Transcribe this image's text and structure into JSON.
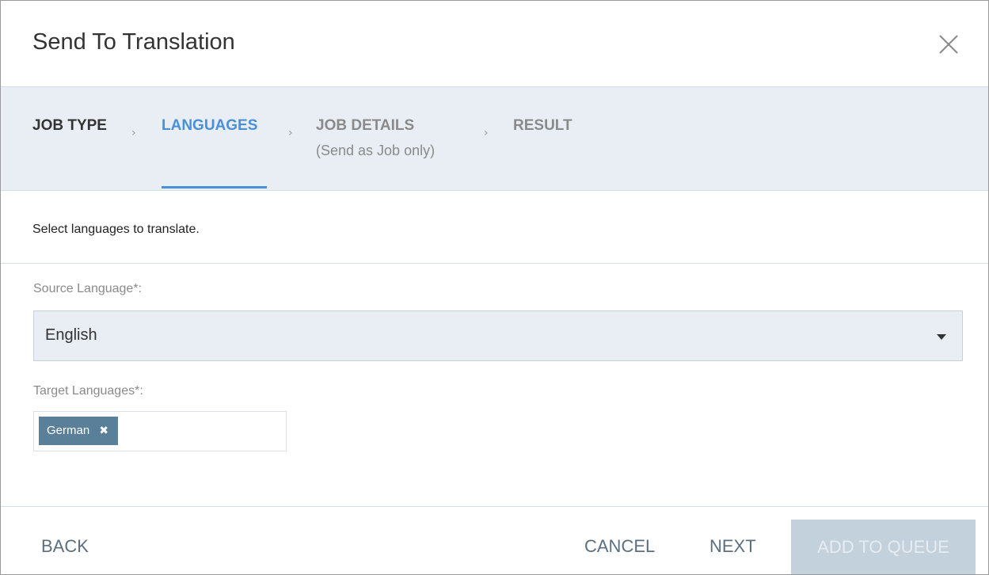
{
  "dialog": {
    "title": "Send To Translation",
    "close_icon": "close-icon"
  },
  "steps": [
    {
      "label": "JOB TYPE",
      "state": "done"
    },
    {
      "label": "LANGUAGES",
      "state": "active"
    },
    {
      "label": "JOB DETAILS",
      "sublabel": "(Send as Job only)",
      "state": "inactive"
    },
    {
      "label": "RESULT",
      "state": "inactive"
    }
  ],
  "step_separator_icon": "chevron-right-icon",
  "instruction": "Select languages to translate.",
  "source_language": {
    "label": "Source Language*:",
    "value": "English",
    "dropdown_icon": "caret-down-icon"
  },
  "target_languages": {
    "label": "Target Languages*:",
    "tags": [
      {
        "label": "German",
        "remove_icon": "remove-tag-icon",
        "remove_glyph": "✖"
      }
    ]
  },
  "footer": {
    "back_label": "BACK",
    "cancel_label": "CANCEL",
    "next_label": "NEXT",
    "add_to_queue_label": "ADD TO QUEUE"
  },
  "colors": {
    "active_step": "#4a90d9",
    "steps_background": "#e8eef4",
    "tag_background": "#5a7f98",
    "disabled_button": "#c3d1dc"
  }
}
